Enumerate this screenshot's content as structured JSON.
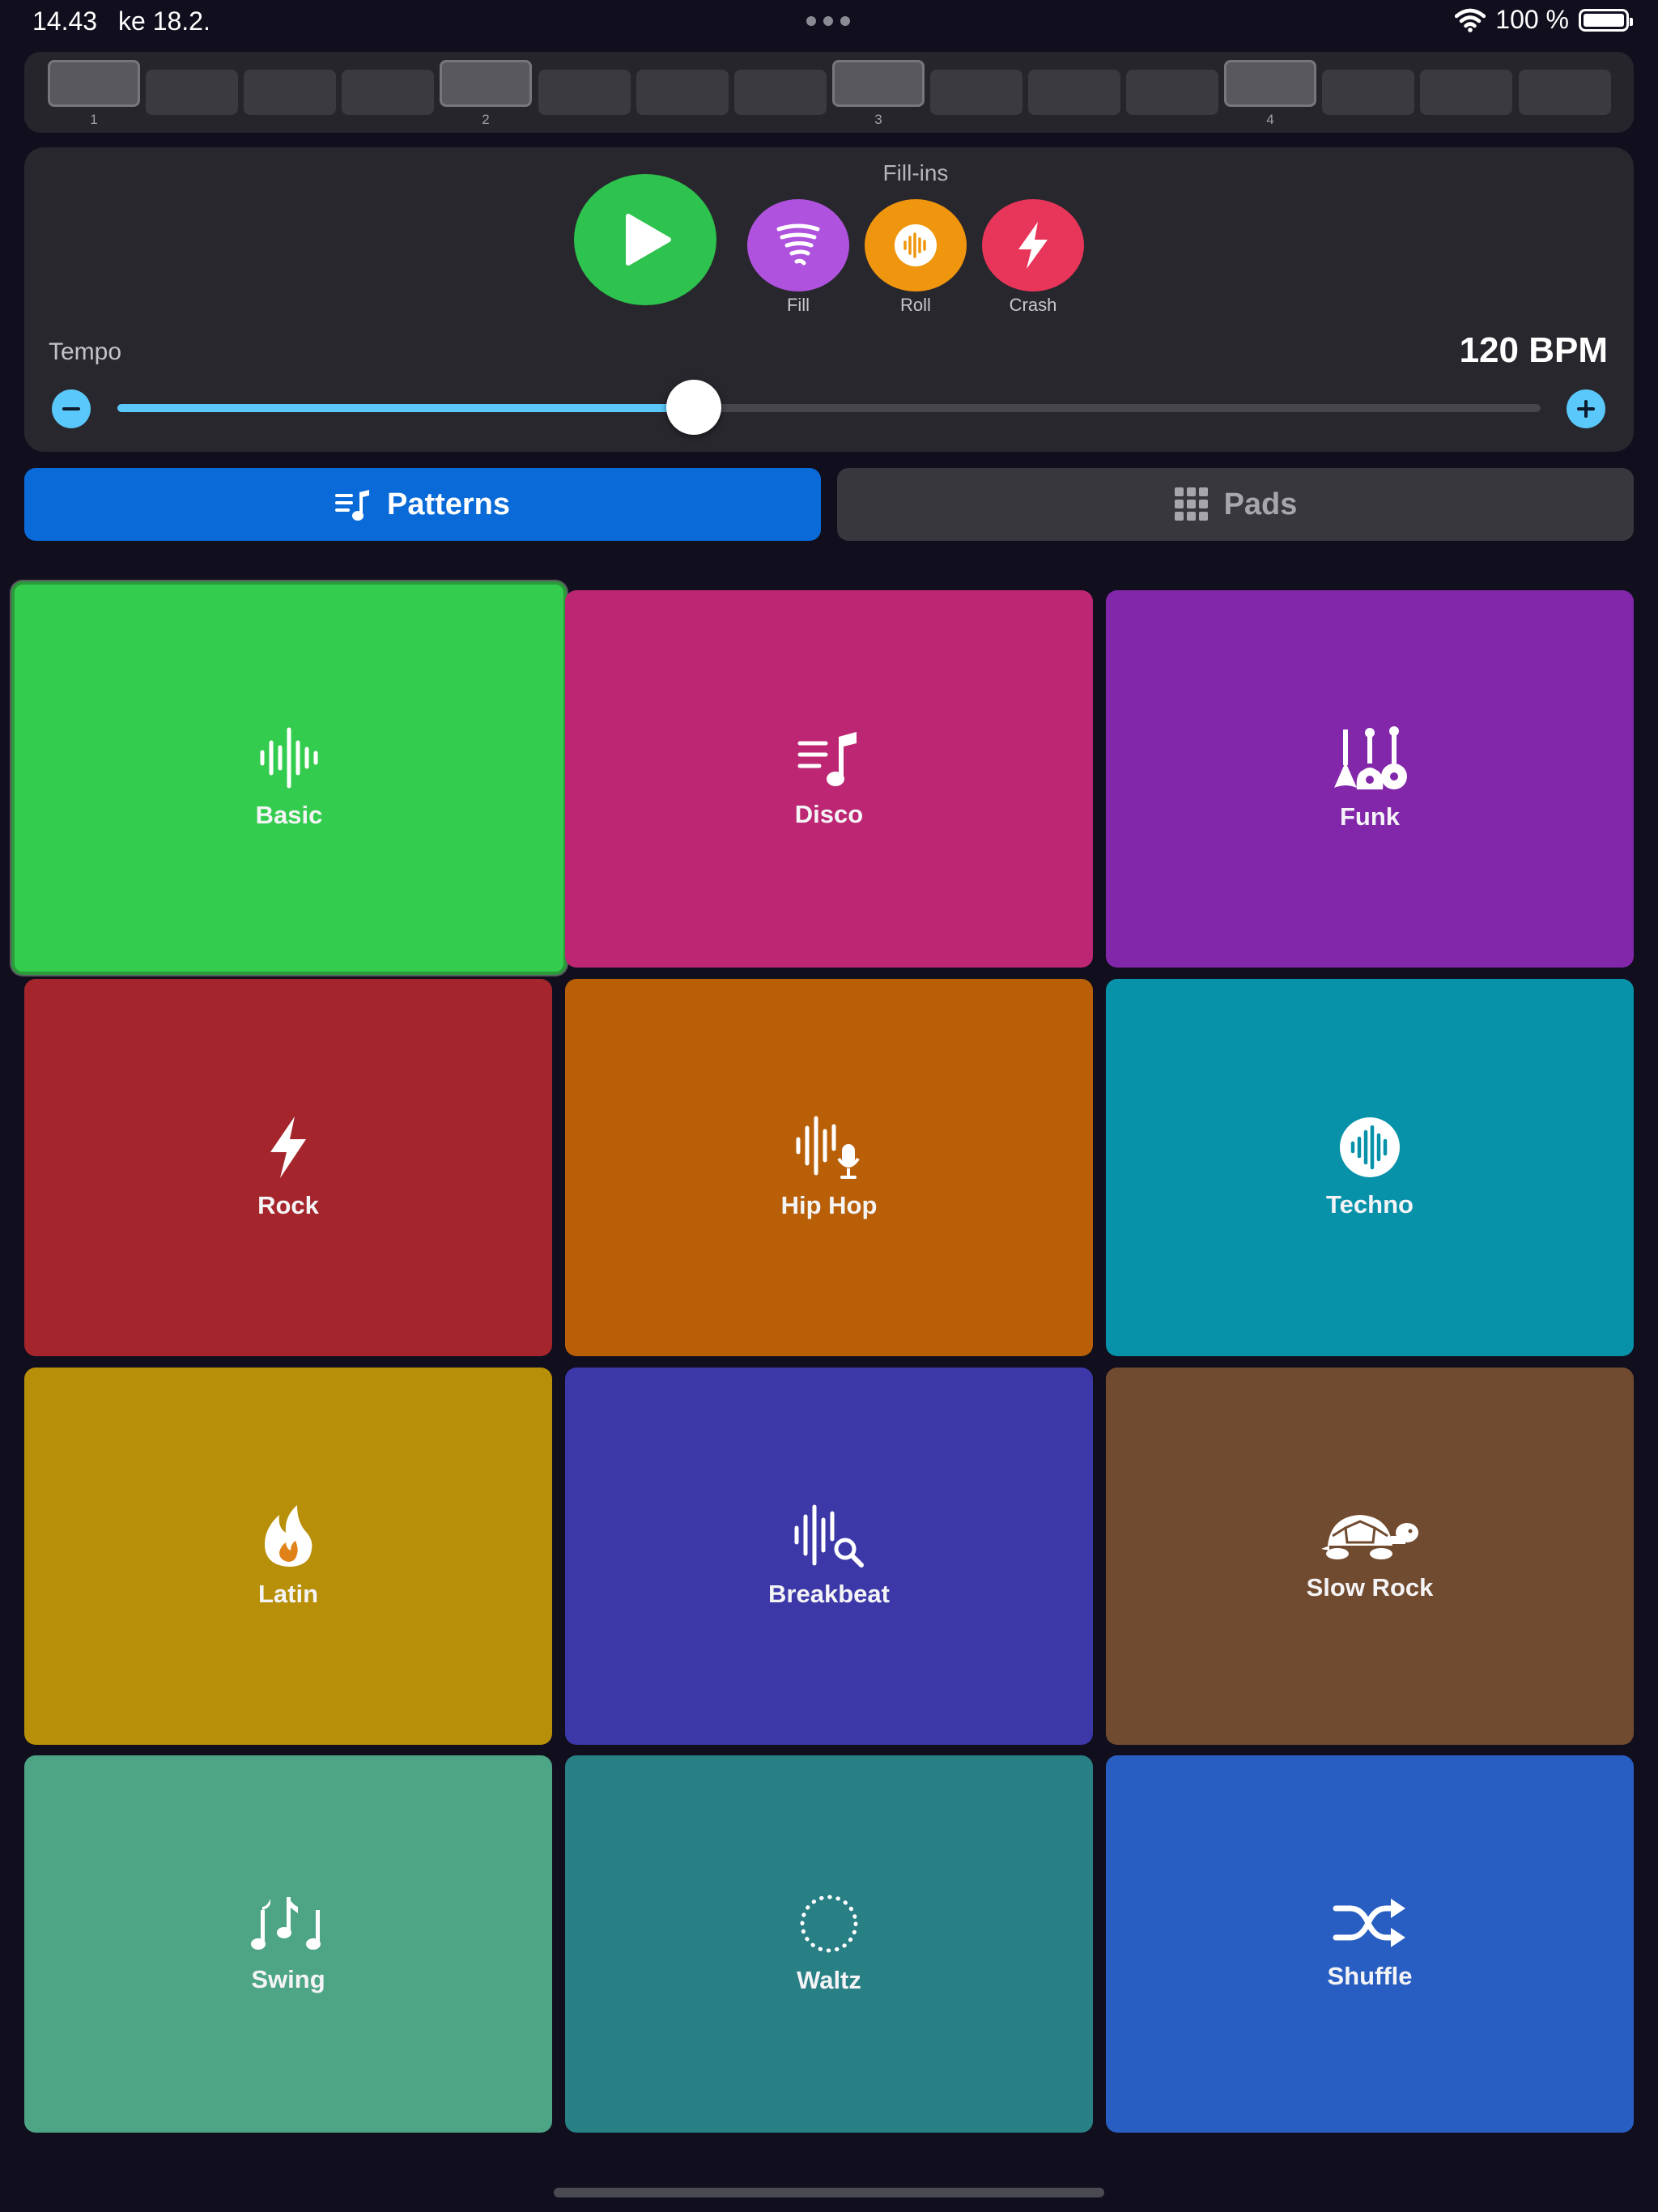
{
  "status_bar": {
    "time": "14.43",
    "date": "ke 18.2.",
    "battery": "100 %"
  },
  "step_strip": {
    "steps": [
      {
        "beat": true,
        "number": "1"
      },
      {
        "beat": false
      },
      {
        "beat": false
      },
      {
        "beat": false
      },
      {
        "beat": true,
        "number": "2"
      },
      {
        "beat": false
      },
      {
        "beat": false
      },
      {
        "beat": false
      },
      {
        "beat": true,
        "number": "3"
      },
      {
        "beat": false
      },
      {
        "beat": false
      },
      {
        "beat": false
      },
      {
        "beat": true,
        "number": "4"
      },
      {
        "beat": false
      },
      {
        "beat": false
      },
      {
        "beat": false
      }
    ]
  },
  "fill_ins": {
    "title": "Fill-ins",
    "items": [
      {
        "label": "Fill",
        "color": "#af52de",
        "icon": "tornado-icon"
      },
      {
        "label": "Roll",
        "color": "#f0960e",
        "icon": "waveform-circle-icon"
      },
      {
        "label": "Crash",
        "color": "#e8365a",
        "icon": "bolt-icon"
      }
    ]
  },
  "tempo": {
    "label": "Tempo",
    "bpm_display": "120 BPM",
    "bpm": 120,
    "slider_fraction": 0.405
  },
  "tabs": {
    "patterns": "Patterns",
    "pads": "Pads"
  },
  "patterns": [
    {
      "label": "Basic",
      "color": "#34cc4e",
      "icon": "waveform-icon",
      "selected": true
    },
    {
      "label": "Disco",
      "color": "#bc2673",
      "icon": "music-list-icon"
    },
    {
      "label": "Funk",
      "color": "#8226aa",
      "icon": "guitars-icon"
    },
    {
      "label": "Rock",
      "color": "#a4262c",
      "icon": "bolt-icon"
    },
    {
      "label": "Hip Hop",
      "color": "#b85f08",
      "icon": "waveform-mic-icon"
    },
    {
      "label": "Techno",
      "color": "#0792aa",
      "icon": "waveform-circle-icon"
    },
    {
      "label": "Latin",
      "color": "#b88f08",
      "icon": "flame-icon"
    },
    {
      "label": "Breakbeat",
      "color": "#3c38a8",
      "icon": "waveform-search-icon"
    },
    {
      "label": "Slow Rock",
      "color": "#714b2f",
      "icon": "tortoise-icon"
    },
    {
      "label": "Swing",
      "color": "#4ea585",
      "icon": "music-notes-icon"
    },
    {
      "label": "Waltz",
      "color": "#287f84",
      "icon": "dotted-circle-icon"
    },
    {
      "label": "Shuffle",
      "color": "#285ec1",
      "icon": "shuffle-icon"
    }
  ]
}
